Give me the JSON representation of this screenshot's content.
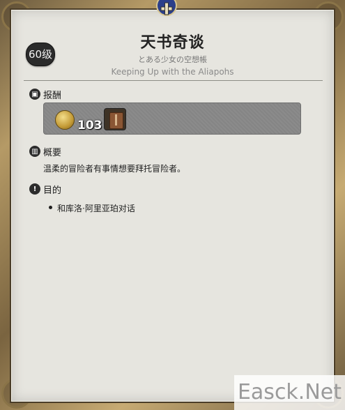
{
  "quest": {
    "level": "60级",
    "title": "天书奇谈",
    "subtitle_jp": "とある少女の空想帳",
    "subtitle_en": "Keeping Up with the Aliapohs"
  },
  "rewards": {
    "heading": "报酬",
    "gil_amount": "103",
    "item_icon": "book-item-icon"
  },
  "summary": {
    "heading": "概要",
    "text": "温柔的冒险者有事情想要拜托冒险者。"
  },
  "objective": {
    "heading": "目的",
    "items": [
      "和库洛·阿里亚珀对话"
    ]
  },
  "watermark": "Easck.Net"
}
